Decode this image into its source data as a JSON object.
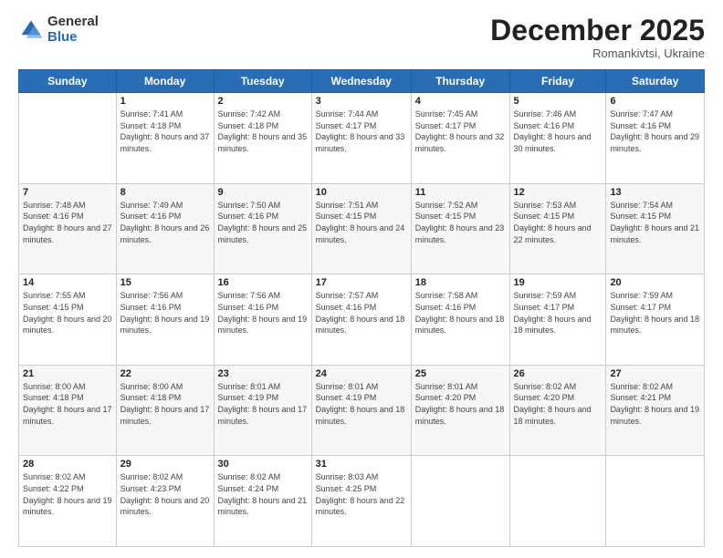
{
  "logo": {
    "general": "General",
    "blue": "Blue"
  },
  "header": {
    "month": "December 2025",
    "location": "Romankivtsi, Ukraine"
  },
  "weekdays": [
    "Sunday",
    "Monday",
    "Tuesday",
    "Wednesday",
    "Thursday",
    "Friday",
    "Saturday"
  ],
  "weeks": [
    [
      {
        "day": "",
        "sunrise": "",
        "sunset": "",
        "daylight": ""
      },
      {
        "day": "1",
        "sunrise": "7:41 AM",
        "sunset": "4:18 PM",
        "daylight": "8 hours and 37 minutes."
      },
      {
        "day": "2",
        "sunrise": "7:42 AM",
        "sunset": "4:18 PM",
        "daylight": "8 hours and 35 minutes."
      },
      {
        "day": "3",
        "sunrise": "7:44 AM",
        "sunset": "4:17 PM",
        "daylight": "8 hours and 33 minutes."
      },
      {
        "day": "4",
        "sunrise": "7:45 AM",
        "sunset": "4:17 PM",
        "daylight": "8 hours and 32 minutes."
      },
      {
        "day": "5",
        "sunrise": "7:46 AM",
        "sunset": "4:16 PM",
        "daylight": "8 hours and 30 minutes."
      },
      {
        "day": "6",
        "sunrise": "7:47 AM",
        "sunset": "4:16 PM",
        "daylight": "8 hours and 29 minutes."
      }
    ],
    [
      {
        "day": "7",
        "sunrise": "7:48 AM",
        "sunset": "4:16 PM",
        "daylight": "8 hours and 27 minutes."
      },
      {
        "day": "8",
        "sunrise": "7:49 AM",
        "sunset": "4:16 PM",
        "daylight": "8 hours and 26 minutes."
      },
      {
        "day": "9",
        "sunrise": "7:50 AM",
        "sunset": "4:16 PM",
        "daylight": "8 hours and 25 minutes."
      },
      {
        "day": "10",
        "sunrise": "7:51 AM",
        "sunset": "4:15 PM",
        "daylight": "8 hours and 24 minutes."
      },
      {
        "day": "11",
        "sunrise": "7:52 AM",
        "sunset": "4:15 PM",
        "daylight": "8 hours and 23 minutes."
      },
      {
        "day": "12",
        "sunrise": "7:53 AM",
        "sunset": "4:15 PM",
        "daylight": "8 hours and 22 minutes."
      },
      {
        "day": "13",
        "sunrise": "7:54 AM",
        "sunset": "4:15 PM",
        "daylight": "8 hours and 21 minutes."
      }
    ],
    [
      {
        "day": "14",
        "sunrise": "7:55 AM",
        "sunset": "4:15 PM",
        "daylight": "8 hours and 20 minutes."
      },
      {
        "day": "15",
        "sunrise": "7:56 AM",
        "sunset": "4:16 PM",
        "daylight": "8 hours and 19 minutes."
      },
      {
        "day": "16",
        "sunrise": "7:56 AM",
        "sunset": "4:16 PM",
        "daylight": "8 hours and 19 minutes."
      },
      {
        "day": "17",
        "sunrise": "7:57 AM",
        "sunset": "4:16 PM",
        "daylight": "8 hours and 18 minutes."
      },
      {
        "day": "18",
        "sunrise": "7:58 AM",
        "sunset": "4:16 PM",
        "daylight": "8 hours and 18 minutes."
      },
      {
        "day": "19",
        "sunrise": "7:59 AM",
        "sunset": "4:17 PM",
        "daylight": "8 hours and 18 minutes."
      },
      {
        "day": "20",
        "sunrise": "7:59 AM",
        "sunset": "4:17 PM",
        "daylight": "8 hours and 18 minutes."
      }
    ],
    [
      {
        "day": "21",
        "sunrise": "8:00 AM",
        "sunset": "4:18 PM",
        "daylight": "8 hours and 17 minutes."
      },
      {
        "day": "22",
        "sunrise": "8:00 AM",
        "sunset": "4:18 PM",
        "daylight": "8 hours and 17 minutes."
      },
      {
        "day": "23",
        "sunrise": "8:01 AM",
        "sunset": "4:19 PM",
        "daylight": "8 hours and 17 minutes."
      },
      {
        "day": "24",
        "sunrise": "8:01 AM",
        "sunset": "4:19 PM",
        "daylight": "8 hours and 18 minutes."
      },
      {
        "day": "25",
        "sunrise": "8:01 AM",
        "sunset": "4:20 PM",
        "daylight": "8 hours and 18 minutes."
      },
      {
        "day": "26",
        "sunrise": "8:02 AM",
        "sunset": "4:20 PM",
        "daylight": "8 hours and 18 minutes."
      },
      {
        "day": "27",
        "sunrise": "8:02 AM",
        "sunset": "4:21 PM",
        "daylight": "8 hours and 19 minutes."
      }
    ],
    [
      {
        "day": "28",
        "sunrise": "8:02 AM",
        "sunset": "4:22 PM",
        "daylight": "8 hours and 19 minutes."
      },
      {
        "day": "29",
        "sunrise": "8:02 AM",
        "sunset": "4:23 PM",
        "daylight": "8 hours and 20 minutes."
      },
      {
        "day": "30",
        "sunrise": "8:02 AM",
        "sunset": "4:24 PM",
        "daylight": "8 hours and 21 minutes."
      },
      {
        "day": "31",
        "sunrise": "8:03 AM",
        "sunset": "4:25 PM",
        "daylight": "8 hours and 22 minutes."
      },
      {
        "day": "",
        "sunrise": "",
        "sunset": "",
        "daylight": ""
      },
      {
        "day": "",
        "sunrise": "",
        "sunset": "",
        "daylight": ""
      },
      {
        "day": "",
        "sunrise": "",
        "sunset": "",
        "daylight": ""
      }
    ]
  ]
}
